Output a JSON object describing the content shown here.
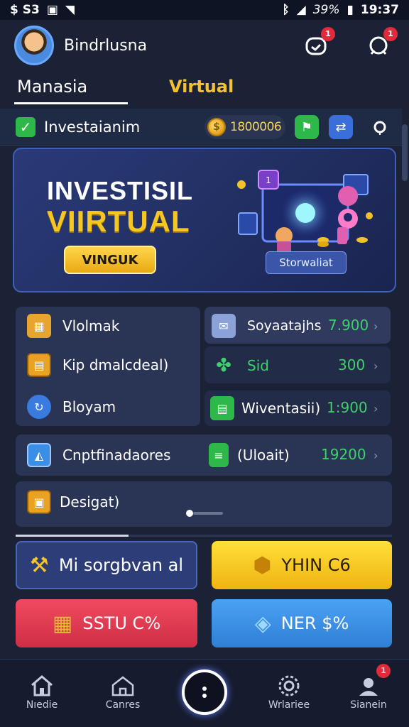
{
  "status_bar": {
    "left_text": "$ S3",
    "battery": "39%",
    "time": "19:37"
  },
  "header": {
    "username": "Bindrlusna",
    "notif_badge": "1",
    "chat_badge": "1"
  },
  "tabs": [
    {
      "label": "Manasia"
    },
    {
      "label": "Virtual"
    }
  ],
  "balance": {
    "label": "Investaianim",
    "coin_value": "1800006"
  },
  "banner": {
    "title_line1": "INVESTISIL",
    "title_line2": "VIIRTUAL",
    "button_label": "VINGUK",
    "tag_label": "Storwaliat",
    "badge_label": "1"
  },
  "left_list": [
    {
      "label": "Vlolmak",
      "icon": "box-icon"
    },
    {
      "label": "Kip dmalcdeal)",
      "icon": "wallet-icon"
    },
    {
      "label": "Bloyam",
      "icon": "refresh-icon"
    }
  ],
  "right_list": [
    {
      "label": "Soyaatajhs",
      "value": "7.900",
      "icon": "document-icon"
    },
    {
      "label": "Sid",
      "value": "300",
      "icon": "plant-icon"
    },
    {
      "label": "Wiventasii)",
      "value": "1:900",
      "icon": "ledger-icon"
    }
  ],
  "wide_row": {
    "left_label": "Cnptfinadaores",
    "right_label": "(Uloait)",
    "value": "19200"
  },
  "deposit": {
    "label": "Desigat)"
  },
  "progress": {
    "fraction": 0.3
  },
  "actions": [
    {
      "label": "Mi sorgbvan al",
      "color": "#2c3d78"
    },
    {
      "label": "YHIN C6",
      "color": "#f4c62c"
    },
    {
      "label": "SSTU C%",
      "color": "#e0394f"
    },
    {
      "label": "NER $%",
      "color": "#3a8ee6"
    }
  ],
  "bottom_nav": [
    {
      "label": "Nıedie",
      "icon": "home-icon"
    },
    {
      "label": "Canres",
      "icon": "house-outline-icon"
    },
    {
      "label": "Wrlariee",
      "icon": "gear-icon"
    },
    {
      "label": "Sianein",
      "icon": "profile-icon",
      "badge": "1"
    }
  ],
  "colors": {
    "accent_gold": "#f2c230",
    "value_green": "#3fd06c",
    "background": "#1b2236"
  }
}
